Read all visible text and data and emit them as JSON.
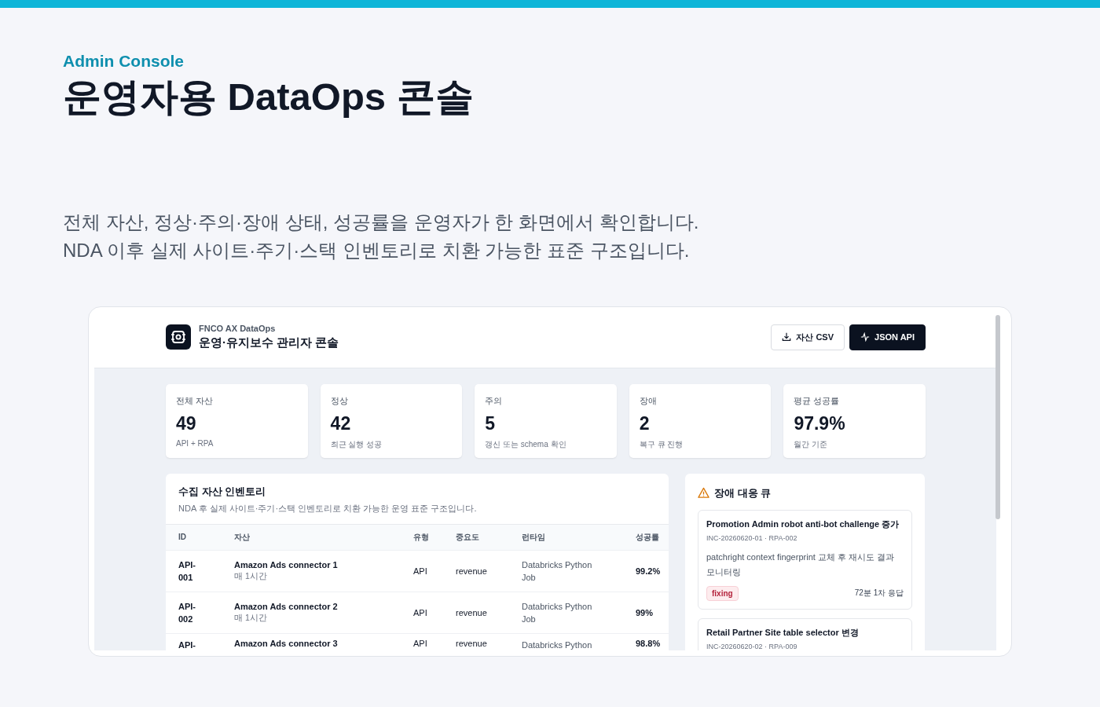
{
  "eyebrow": "Admin Console",
  "title": "운영자용 DataOps 콘솔",
  "intro": [
    "전체 자산, 정상·주의·장애 상태, 성공률을 운영자가 한 화면에서 확인합니다.",
    "NDA 이후 실제 사이트·주기·스택 인벤토리로 치환 가능한 표준 구조입니다."
  ],
  "app": {
    "brand": "FNCO AX DataOps",
    "title": "운영·유지보수 관리자 콘솔",
    "buttons": [
      {
        "label": "자산 CSV",
        "kind": "download"
      },
      {
        "label": "JSON API",
        "kind": "api"
      }
    ],
    "stats": [
      {
        "label": "전체 자산",
        "value": "49",
        "note": "API + RPA"
      },
      {
        "label": "정상",
        "value": "42",
        "note": "최근 실행 성공"
      },
      {
        "label": "주의",
        "value": "5",
        "note": "갱신 또는 schema 확인"
      },
      {
        "label": "장애",
        "value": "2",
        "note": "복구 큐 진행"
      },
      {
        "label": "평균 성공률",
        "value": "97.9%",
        "note": "월간 기준"
      }
    ],
    "inventory": {
      "title": "수집 자산 인벤토리",
      "subtitle": "NDA 후 실제 사이트·주기·스택 인벤토리로 치환 가능한 운영 표준 구조입니다.",
      "columns": [
        "ID",
        "자산",
        "유형",
        "중요도",
        "런타임",
        "성공률"
      ],
      "rows": [
        {
          "id": "API-001",
          "asset": "Amazon Ads connector 1",
          "schedule": "매 1시간",
          "type": "API",
          "importance": "revenue",
          "runtime": "Databricks Python Job",
          "rate": "99.2%"
        },
        {
          "id": "API-002",
          "asset": "Amazon Ads connector 2",
          "schedule": "매 1시간",
          "type": "API",
          "importance": "revenue",
          "runtime": "Databricks Python Job",
          "rate": "99%"
        },
        {
          "id": "API-",
          "asset": "Amazon Ads connector 3",
          "type": "API",
          "importance": "revenue",
          "runtime": "Databricks Python",
          "rate": "98.8%"
        }
      ]
    },
    "queue": {
      "title": "장애 대응 큐",
      "items": [
        {
          "title": "Promotion Admin robot anti-bot challenge 증가",
          "ref": "INC-20260620-01 · RPA-002",
          "detail": "patchright context fingerprint 교체 후 재시도 결과 모니터링",
          "status": "fixing",
          "sla": "72분 1차 응답"
        },
        {
          "title": "Retail Partner Site table selector 변경",
          "ref": "INC-20260620-02 · RPA-009"
        }
      ]
    }
  }
}
